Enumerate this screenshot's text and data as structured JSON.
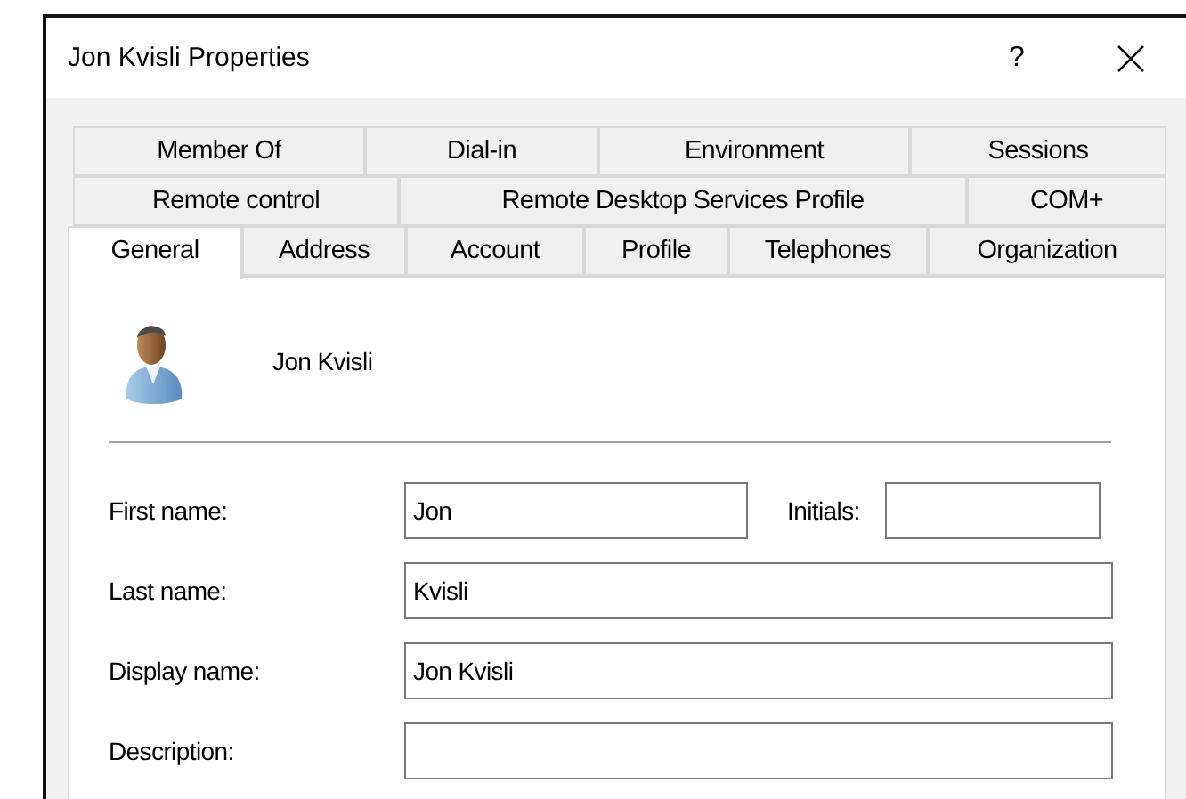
{
  "window": {
    "title": "Jon Kvisli Properties",
    "buttons": [
      {
        "kind": "help",
        "label": "?"
      },
      {
        "kind": "close"
      }
    ]
  },
  "tab_rows": [
    [
      {
        "label": "Member Of",
        "selected": false
      },
      {
        "label": "Dial-in",
        "selected": false
      },
      {
        "label": "Environment",
        "selected": false
      },
      {
        "label": "Sessions",
        "selected": false
      }
    ],
    [
      {
        "label": "Remote control",
        "selected": false
      },
      {
        "label": "Remote Desktop Services Profile",
        "selected": false
      },
      {
        "label": "COM+",
        "selected": false
      }
    ],
    [
      {
        "label": "General",
        "selected": true
      },
      {
        "label": "Address",
        "selected": false
      },
      {
        "label": "Account",
        "selected": false
      },
      {
        "label": "Profile",
        "selected": false
      },
      {
        "label": "Telephones",
        "selected": false
      },
      {
        "label": "Organization",
        "selected": false
      }
    ]
  ],
  "user": {
    "name": "Jon Kvisli"
  },
  "fields": [
    {
      "label": "First name:",
      "value": "Jon",
      "extra": {
        "label": "Initials:"
      }
    },
    {
      "label": "Last name:",
      "value": "Kvisli"
    },
    {
      "label": "Display name:",
      "value": "Jon Kvisli"
    },
    {
      "label": "Description:"
    }
  ]
}
